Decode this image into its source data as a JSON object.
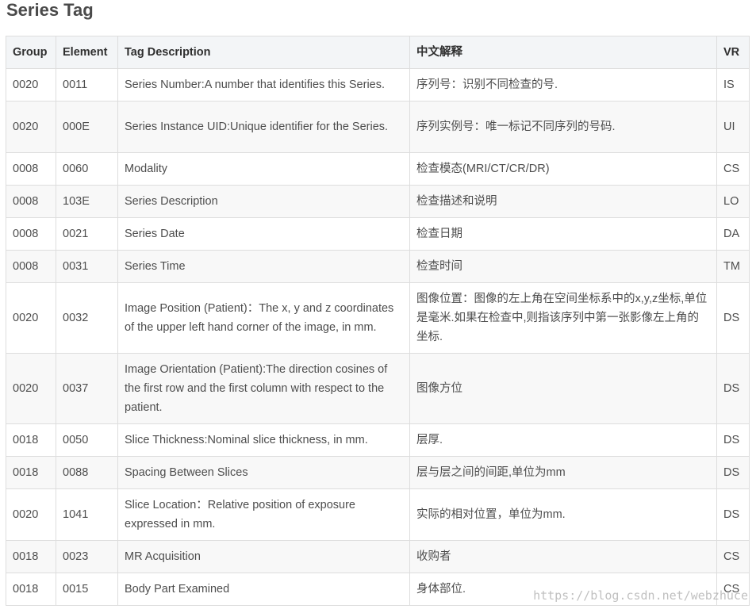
{
  "title": "Series Tag",
  "table": {
    "headers": {
      "group": "Group",
      "element": "Element",
      "desc": "Tag Description",
      "cn": "中文解释",
      "vr": "VR"
    },
    "rows": [
      {
        "group": "0020",
        "element": "0011",
        "desc": "Series Number:A number that identifies this Series.",
        "cn": "序列号：识别不同检查的号.",
        "vr": "IS"
      },
      {
        "group": "0020",
        "element": "000E",
        "desc": "Series Instance UID:Unique identifier for the Series.",
        "cn": "序列实例号：唯一标记不同序列的号码.",
        "vr": "UI"
      },
      {
        "group": "0008",
        "element": "0060",
        "desc": "Modality",
        "cn": "检查模态(MRI/CT/CR/DR)",
        "vr": "CS"
      },
      {
        "group": "0008",
        "element": "103E",
        "desc": "Series Description",
        "cn": "检查描述和说明",
        "vr": "LO"
      },
      {
        "group": "0008",
        "element": "0021",
        "desc": "Series Date",
        "cn": "检查日期",
        "vr": "DA"
      },
      {
        "group": "0008",
        "element": "0031",
        "desc": "Series Time",
        "cn": "检查时间",
        "vr": "TM"
      },
      {
        "group": "0020",
        "element": "0032",
        "desc": "Image Position (Patient)：The x, y and z coordinates of the upper left hand corner of the image, in mm.",
        "cn": "图像位置：图像的左上角在空间坐标系中的x,y,z坐标,单位是毫米.如果在检查中,则指该序列中第一张影像左上角的坐标.",
        "vr": "DS"
      },
      {
        "group": "0020",
        "element": "0037",
        "desc": "Image Orientation (Patient):The direction cosines of the first row and the first column with respect to the patient.",
        "cn": "图像方位",
        "vr": "DS"
      },
      {
        "group": "0018",
        "element": "0050",
        "desc": "Slice Thickness:Nominal slice thickness, in mm.",
        "cn": "层厚.",
        "vr": "DS"
      },
      {
        "group": "0018",
        "element": "0088",
        "desc": "Spacing Between Slices",
        "cn": "层与层之间的间距,单位为mm",
        "vr": "DS"
      },
      {
        "group": "0020",
        "element": "1041",
        "desc": "Slice Location：Relative position of exposure expressed in mm.",
        "cn": "实际的相对位置，单位为mm.",
        "vr": "DS"
      },
      {
        "group": "0018",
        "element": "0023",
        "desc": "MR Acquisition",
        "cn": "收购者",
        "vr": "CS"
      },
      {
        "group": "0018",
        "element": "0015",
        "desc": "Body Part Examined",
        "cn": "身体部位.",
        "vr": "CS"
      }
    ]
  },
  "watermark": "https://blog.csdn.net/webzhuce"
}
